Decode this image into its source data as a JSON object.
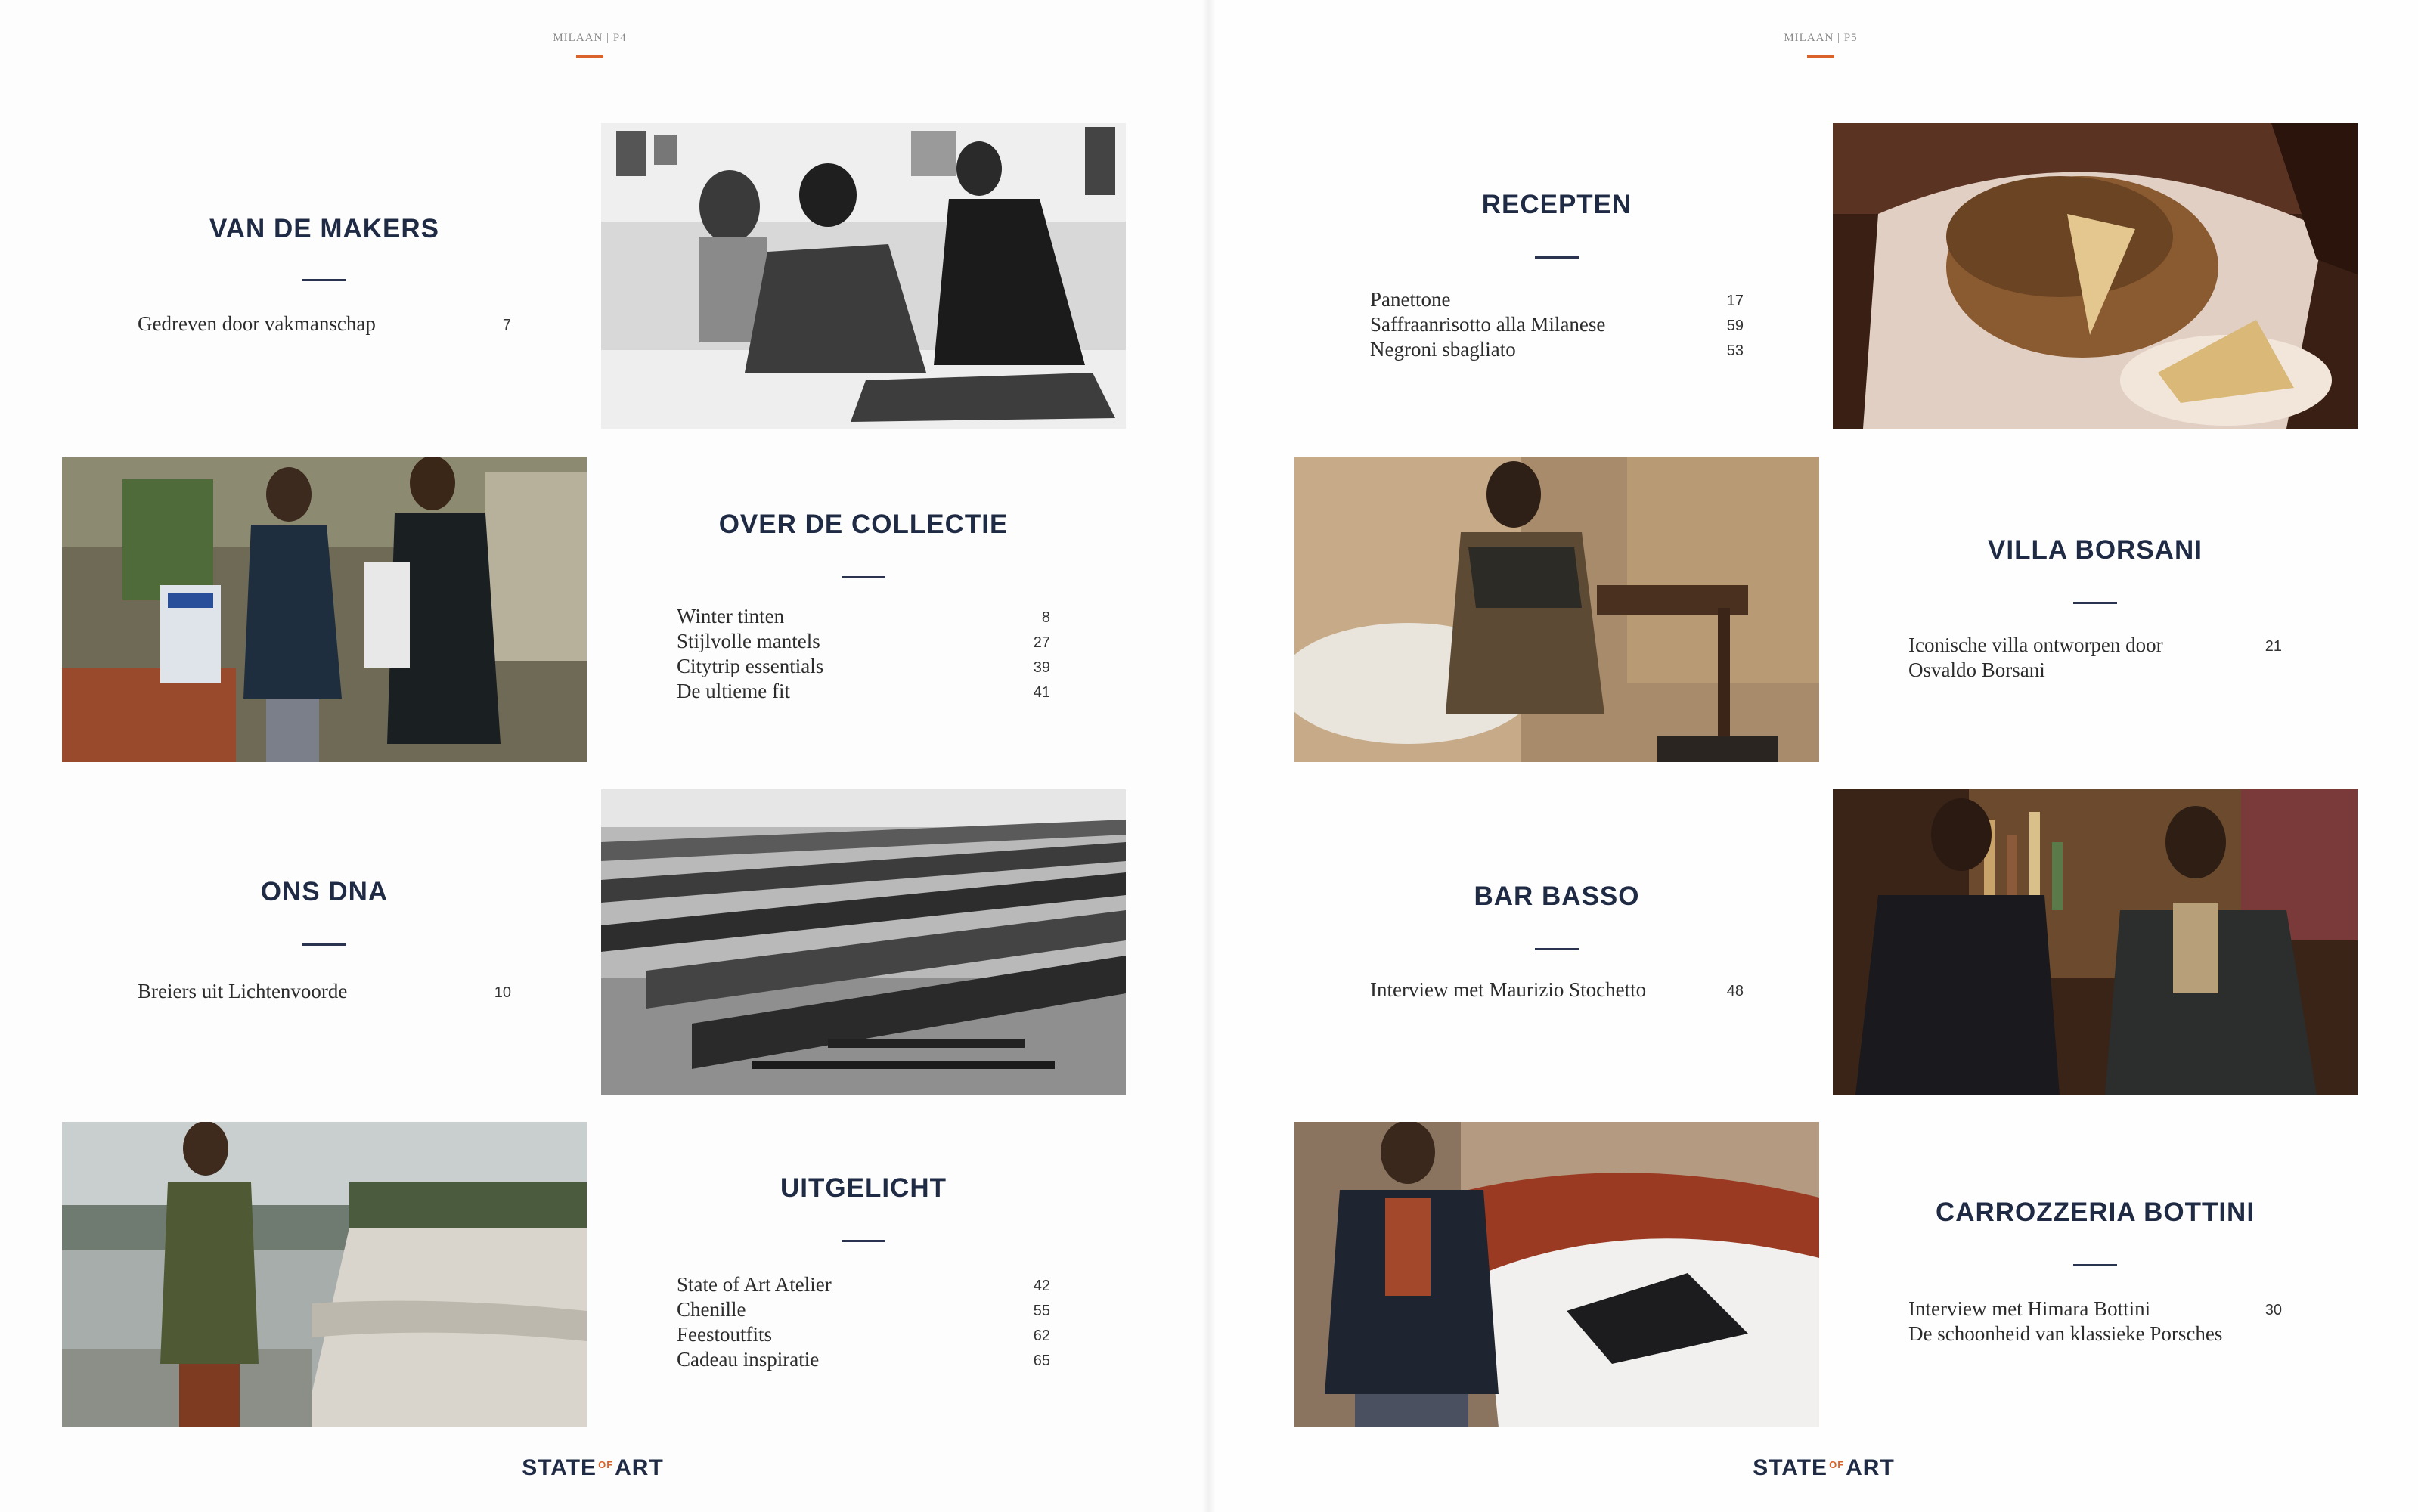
{
  "pages": [
    {
      "folio": "MILAAN | P4",
      "sections": [
        {
          "title": "VAN DE MAKERS",
          "items": [
            {
              "label": "Gedreven door vakmanschap",
              "page": "7"
            }
          ]
        },
        {
          "title": "OVER DE COLLECTIE",
          "items": [
            {
              "label": "Winter tinten",
              "page": "8"
            },
            {
              "label": "Stijlvolle mantels",
              "page": "27"
            },
            {
              "label": "Citytrip essentials",
              "page": "39"
            },
            {
              "label": "De ultieme fit",
              "page": "41"
            }
          ]
        },
        {
          "title": "ONS DNA",
          "items": [
            {
              "label": "Breiers uit Lichtenvoorde",
              "page": "10"
            }
          ]
        },
        {
          "title": "UITGELICHT",
          "items": [
            {
              "label": "State of Art Atelier",
              "page": "42"
            },
            {
              "label": "Chenille",
              "page": "55"
            },
            {
              "label": "Feestoutfits",
              "page": "62"
            },
            {
              "label": "Cadeau inspiratie",
              "page": "65"
            }
          ]
        }
      ],
      "brand": {
        "left": "STATE",
        "of": "OF",
        "right": "ART"
      }
    },
    {
      "folio": "MILAAN | P5",
      "sections": [
        {
          "title": "RECEPTEN",
          "items": [
            {
              "label": "Panettone",
              "page": "17"
            },
            {
              "label": "Saffraanrisotto alla Milanese",
              "page": "59"
            },
            {
              "label": "Negroni sbagliato",
              "page": "53"
            }
          ]
        },
        {
          "title": "VILLA BORSANI",
          "items": [
            {
              "label": "Iconische villa ontworpen door",
              "page": "21"
            },
            {
              "label": "Osvaldo Borsani",
              "page": ""
            }
          ]
        },
        {
          "title": "BAR BASSO",
          "items": [
            {
              "label": "Interview met Maurizio Stochetto",
              "page": "48"
            }
          ]
        },
        {
          "title": "CARROZZERIA BOTTINI",
          "items": [
            {
              "label": "Interview met Himara Bottini",
              "page": "30"
            },
            {
              "label": "De schoonheid van klassieke Porsches",
              "page": ""
            }
          ]
        }
      ],
      "brand": {
        "left": "STATE",
        "of": "OF",
        "right": "ART"
      }
    }
  ],
  "colors": {
    "title": "#1f2a44",
    "accent": "#d9632a",
    "text": "#2c2c2c"
  }
}
